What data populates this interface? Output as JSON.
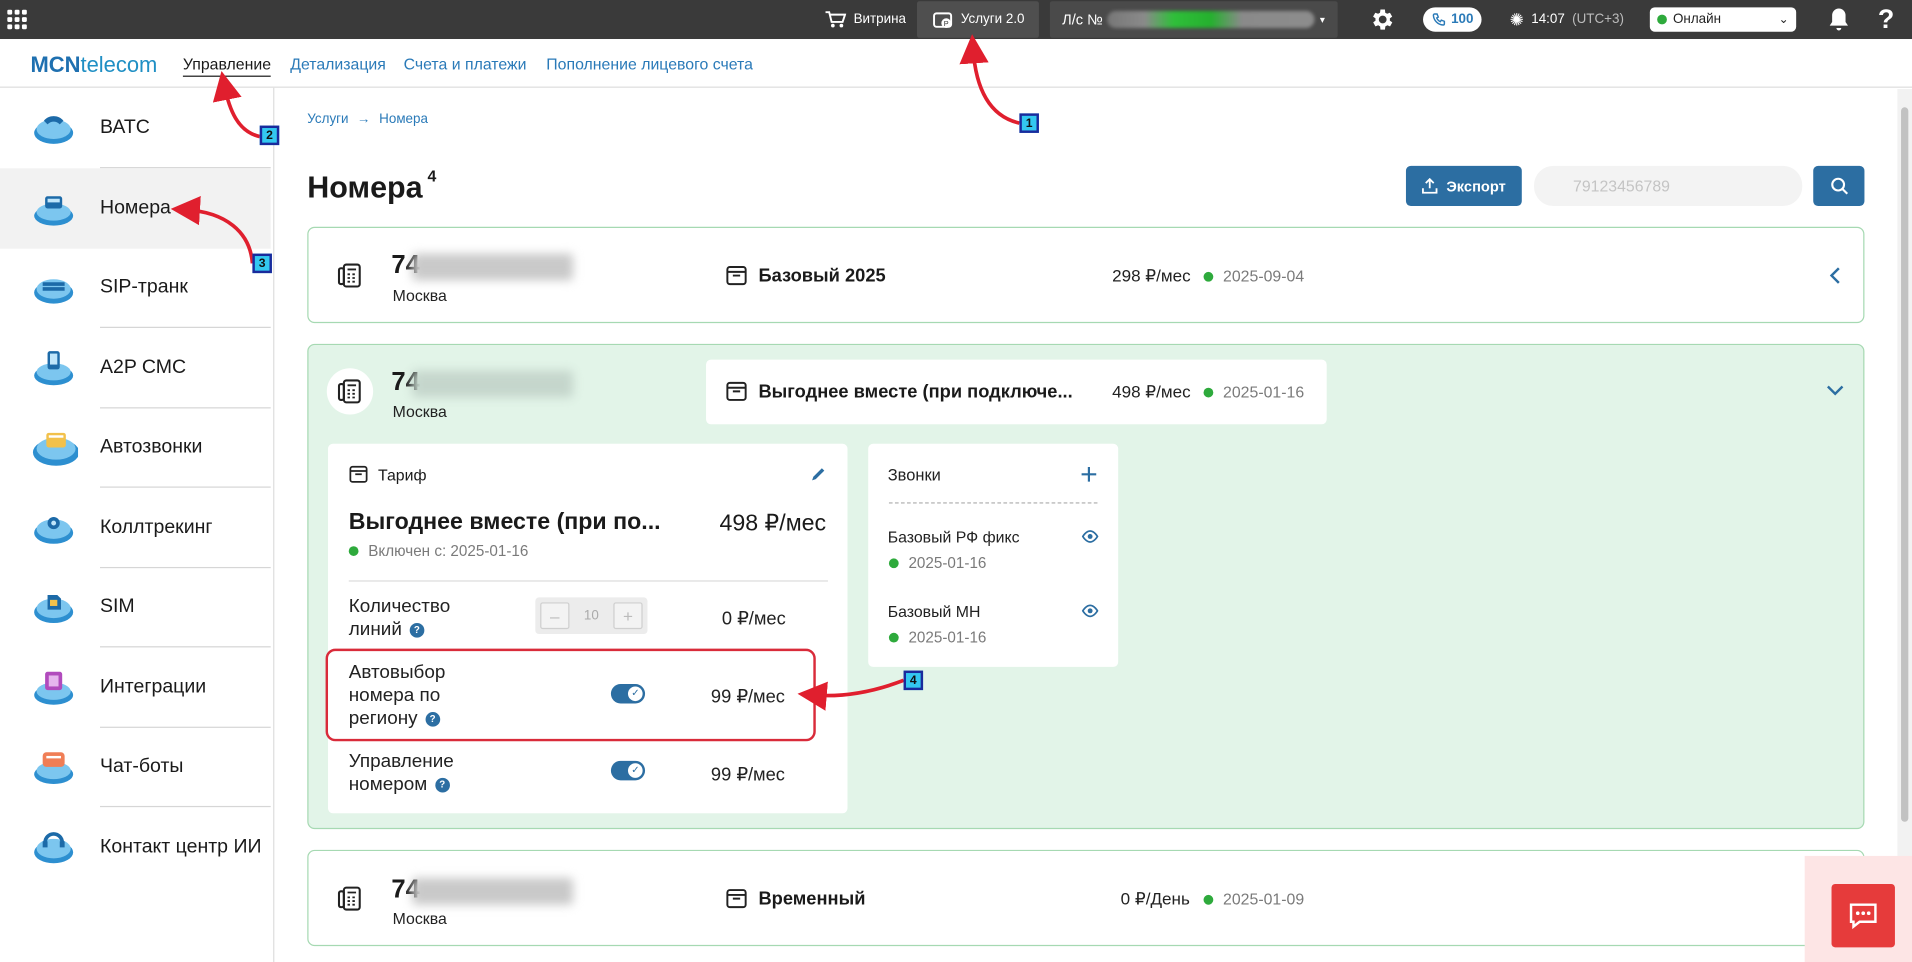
{
  "topbar": {
    "vitrina": "Витрина",
    "services": "Услуги 2.0",
    "account_prefix": "Л/с №",
    "calls_count": "100",
    "time": "14:07",
    "timezone": "(UTC+3)",
    "status": "Онлайн",
    "help": "?"
  },
  "header": {
    "logo_bold": "MCN",
    "logo_rest": "telecom",
    "nav": [
      "Управление",
      "Детализация",
      "Счета и платежи",
      "Пополнение лицевого счета"
    ]
  },
  "sidebar": {
    "items": [
      {
        "label": "ВАТС",
        "icon": "pbx-cloud-icon"
      },
      {
        "label": "Номера",
        "icon": "numbers-cloud-icon",
        "active": true
      },
      {
        "label": "SIP-транк",
        "icon": "sip-trunk-cloud-icon"
      },
      {
        "label": "A2P СМС",
        "icon": "sms-cloud-icon"
      },
      {
        "label": "Автозвонки",
        "icon": "autocalls-cloud-icon"
      },
      {
        "label": "Коллтрекинг",
        "icon": "calltracking-cloud-icon"
      },
      {
        "label": "SIM",
        "icon": "sim-cloud-icon"
      },
      {
        "label": "Интеграции",
        "icon": "integrations-cloud-icon"
      },
      {
        "label": "Чат-боты",
        "icon": "chatbots-cloud-icon"
      },
      {
        "label": "Контакт центр ИИ",
        "icon": "ai-contact-center-cloud-icon"
      }
    ]
  },
  "breadcrumbs": [
    "Услуги",
    "Номера"
  ],
  "page": {
    "title": "Номера",
    "count": "4",
    "export_label": "Экспорт",
    "search_placeholder": "79123456789"
  },
  "numbers": [
    {
      "prefix": "74",
      "city": "Москва",
      "tariff": "Базовый 2025",
      "price": "298 ₽/мес",
      "date": "2025-09-04"
    },
    {
      "prefix": "74",
      "city": "Москва",
      "tariff": "Выгоднее вместе (при подключе...",
      "price": "498 ₽/мес",
      "date": "2025-01-16",
      "expanded": true
    },
    {
      "prefix": "74",
      "city": "Москва",
      "tariff": "Временный",
      "price": "0 ₽/День",
      "date": "2025-01-09"
    }
  ],
  "tariff_panel": {
    "heading": "Тариф",
    "name": "Выгоднее вместе (при по...",
    "price": "498 ₽/мес",
    "enabled_since": "Включен с: 2025-01-16",
    "lines_label_1": "Количество",
    "lines_label_2": "линий",
    "lines_value": "10",
    "lines_price": "0 ₽/мес",
    "auto_label_1": "Автовыбор",
    "auto_label_2": "номера по",
    "auto_label_3": "региону",
    "auto_price": "99 ₽/мес",
    "manage_label_1": "Управление",
    "manage_label_2": "номером",
    "manage_price": "99 ₽/мес"
  },
  "calls_panel": {
    "heading": "Звонки",
    "items": [
      {
        "name": "Базовый РФ фикс",
        "date": "2025-01-16"
      },
      {
        "name": "Базовый МН",
        "date": "2025-01-16"
      }
    ]
  },
  "annotations": [
    "1",
    "2",
    "3",
    "4"
  ],
  "colors": {
    "accent": "#2c6ea2",
    "green": "#2eaa3c",
    "annotation": "#d92b3a"
  }
}
